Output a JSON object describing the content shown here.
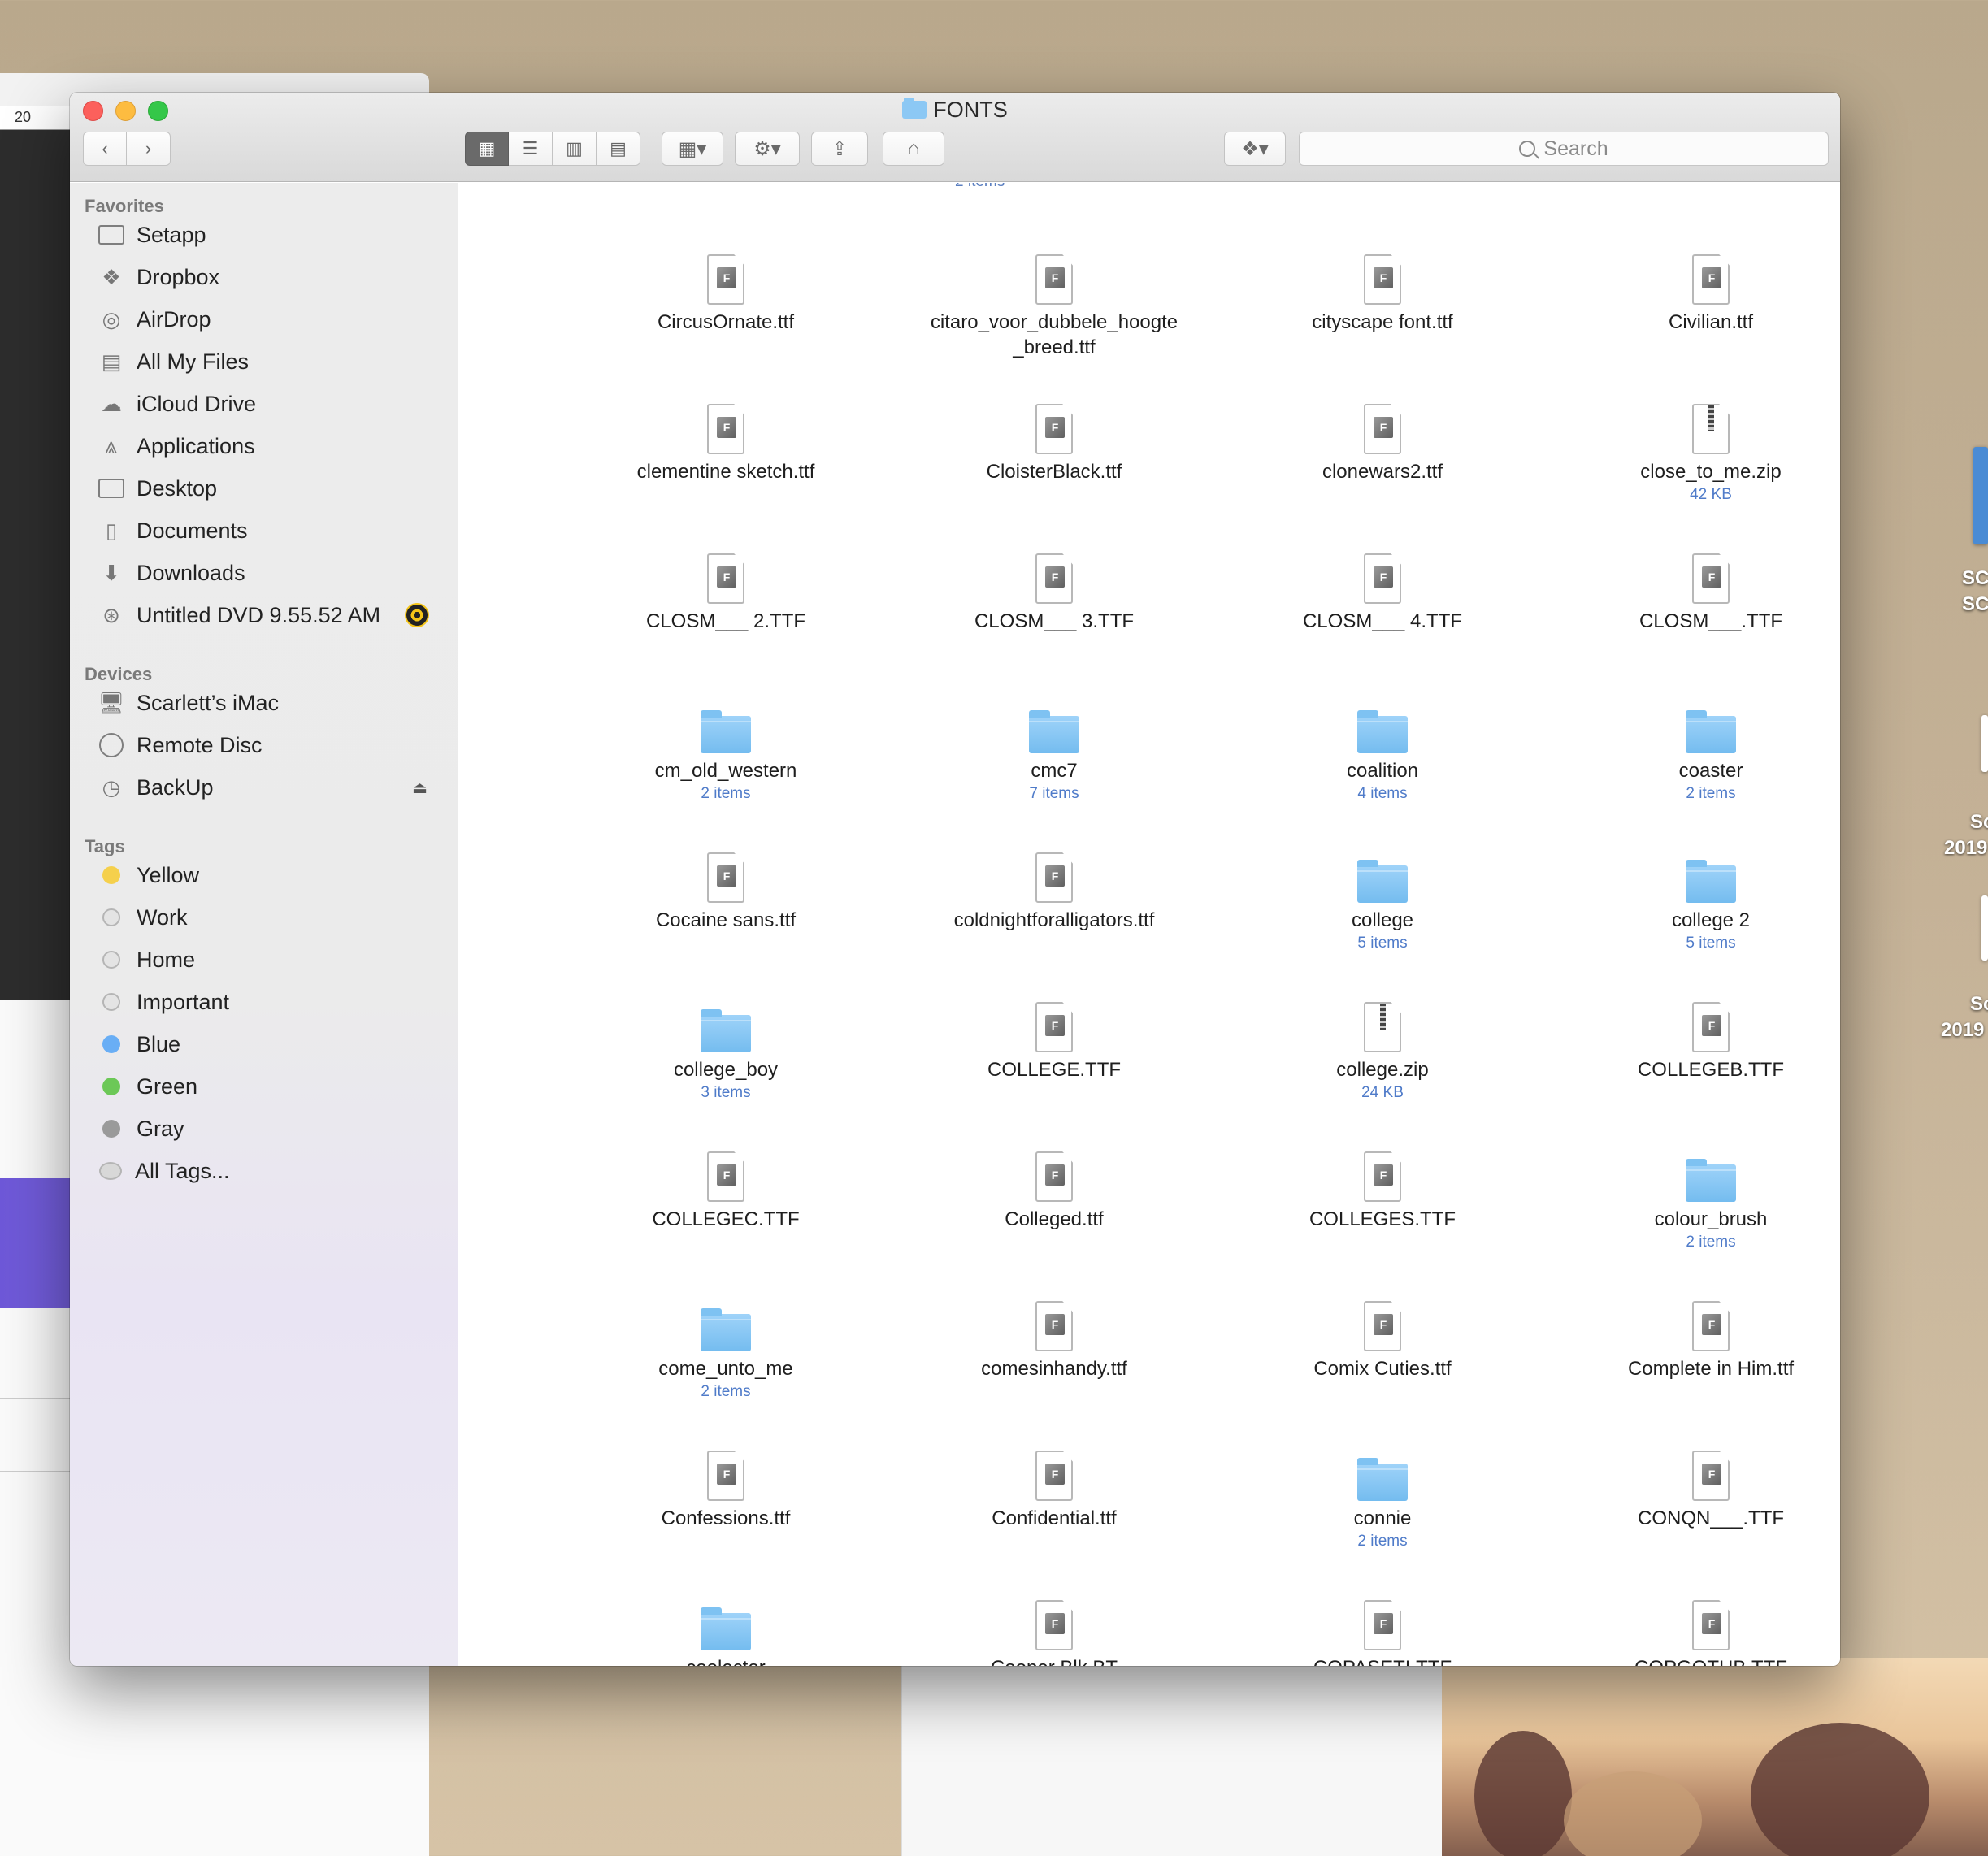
{
  "window": {
    "title": "FONTS"
  },
  "background": {
    "ruler_label": "20"
  },
  "desktop": {
    "items": [
      {
        "label": "SC"
      },
      {
        "label": "SC"
      },
      {
        "label": "Sc"
      },
      {
        "label": "2019"
      },
      {
        "label": "Sc"
      },
      {
        "label": "2019"
      }
    ]
  },
  "toolbar": {
    "search_placeholder": "Search"
  },
  "sidebar": {
    "favorites_label": "Favorites",
    "favorites": [
      {
        "label": "Setapp",
        "icon": "folder-icon"
      },
      {
        "label": "Dropbox",
        "icon": "dropbox-icon"
      },
      {
        "label": "AirDrop",
        "icon": "airdrop-icon"
      },
      {
        "label": "All My Files",
        "icon": "all-files-icon"
      },
      {
        "label": "iCloud Drive",
        "icon": "cloud-icon"
      },
      {
        "label": "Applications",
        "icon": "applications-icon"
      },
      {
        "label": "Desktop",
        "icon": "desktop-icon"
      },
      {
        "label": "Documents",
        "icon": "documents-icon"
      },
      {
        "label": "Downloads",
        "icon": "downloads-icon"
      },
      {
        "label": "Untitled DVD 9.55.52 AM",
        "icon": "burn-disc-icon"
      }
    ],
    "devices_label": "Devices",
    "devices": [
      {
        "label": "Scarlett’s iMac",
        "icon": "imac-icon"
      },
      {
        "label": "Remote Disc",
        "icon": "disc-icon"
      },
      {
        "label": "BackUp",
        "icon": "time-machine-icon"
      }
    ],
    "tags_label": "Tags",
    "tags": [
      {
        "label": "Yellow",
        "color": "#f5d04c"
      },
      {
        "label": "Work",
        "color": "#e4e4e4"
      },
      {
        "label": "Home",
        "color": "#e4e4e4"
      },
      {
        "label": "Important",
        "color": "#e4e4e4"
      },
      {
        "label": "Blue",
        "color": "#69aef5"
      },
      {
        "label": "Green",
        "color": "#6cc857"
      },
      {
        "label": "Gray",
        "color": "#9a9a9a"
      },
      {
        "label": "All Tags...",
        "color": "#d8d8d8"
      }
    ]
  },
  "content": {
    "cut_off_label": "2 items",
    "items": [
      {
        "name": "CircusOrnate.ttf",
        "kind": "ttf"
      },
      {
        "name": "citaro_voor_dubbele_hoogte _breed.ttf",
        "kind": "ttf"
      },
      {
        "name": "cityscape font.ttf",
        "kind": "ttf"
      },
      {
        "name": "Civilian.ttf",
        "kind": "ttf"
      },
      {
        "name": "clementine sketch.ttf",
        "kind": "ttf"
      },
      {
        "name": "CloisterBlack.ttf",
        "kind": "ttf"
      },
      {
        "name": "clonewars2.ttf",
        "kind": "ttf"
      },
      {
        "name": "close_to_me.zip",
        "kind": "zip",
        "sub": "42 KB"
      },
      {
        "name": "CLOSM___ 2.TTF",
        "kind": "ttf"
      },
      {
        "name": "CLOSM___ 3.TTF",
        "kind": "ttf"
      },
      {
        "name": "CLOSM___ 4.TTF",
        "kind": "ttf"
      },
      {
        "name": "CLOSM___.TTF",
        "kind": "ttf"
      },
      {
        "name": "cm_old_western",
        "kind": "folder",
        "sub": "2 items"
      },
      {
        "name": "cmc7",
        "kind": "folder",
        "sub": "7 items"
      },
      {
        "name": "coalition",
        "kind": "folder",
        "sub": "4 items"
      },
      {
        "name": "coaster",
        "kind": "folder",
        "sub": "2 items"
      },
      {
        "name": "Cocaine sans.ttf",
        "kind": "ttf"
      },
      {
        "name": "coldnightforalligators.ttf",
        "kind": "ttf"
      },
      {
        "name": "college",
        "kind": "folder",
        "sub": "5 items"
      },
      {
        "name": "college 2",
        "kind": "folder",
        "sub": "5 items"
      },
      {
        "name": "college_boy",
        "kind": "folder",
        "sub": "3 items"
      },
      {
        "name": "COLLEGE.TTF",
        "kind": "ttf"
      },
      {
        "name": "college.zip",
        "kind": "zip",
        "sub": "24 KB"
      },
      {
        "name": "COLLEGEB.TTF",
        "kind": "ttf"
      },
      {
        "name": "COLLEGEC.TTF",
        "kind": "ttf"
      },
      {
        "name": "Colleged.ttf",
        "kind": "ttf"
      },
      {
        "name": "COLLEGES.TTF",
        "kind": "ttf"
      },
      {
        "name": "colour_brush",
        "kind": "folder",
        "sub": "2 items"
      },
      {
        "name": "come_unto_me",
        "kind": "folder",
        "sub": "2 items"
      },
      {
        "name": "comesinhandy.ttf",
        "kind": "ttf"
      },
      {
        "name": "Comix Cuties.ttf",
        "kind": "ttf"
      },
      {
        "name": "Complete in Him.ttf",
        "kind": "ttf"
      },
      {
        "name": "Confessions.ttf",
        "kind": "ttf"
      },
      {
        "name": "Confidential.ttf",
        "kind": "ttf"
      },
      {
        "name": "connie",
        "kind": "folder",
        "sub": "2 items"
      },
      {
        "name": "CONQN___.TTF",
        "kind": "ttf"
      },
      {
        "name": "coolector",
        "kind": "folder"
      },
      {
        "name": "Cooper Blk BT",
        "kind": "ffil"
      },
      {
        "name": "COPASETI.TTF",
        "kind": "ttf"
      },
      {
        "name": "COPGOTHB.TTF",
        "kind": "ttf"
      }
    ]
  }
}
